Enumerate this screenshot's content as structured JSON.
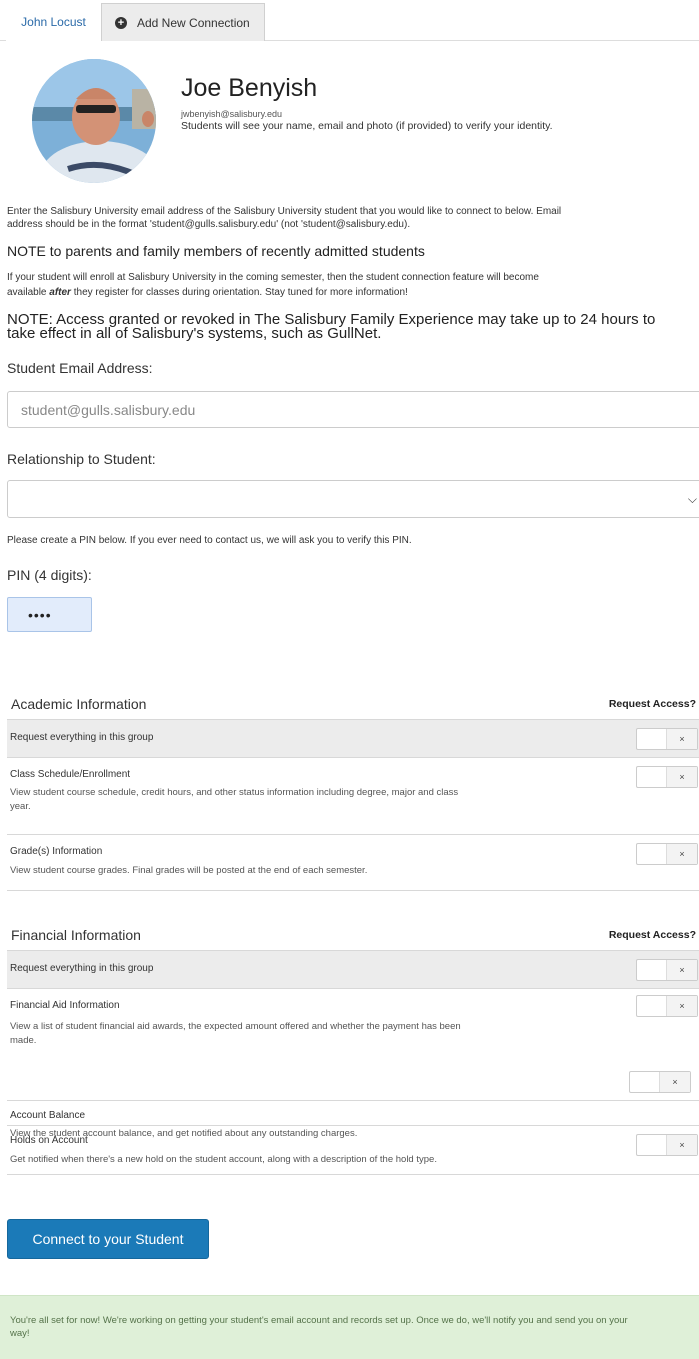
{
  "tabs": {
    "active_label": "John Locust",
    "add_label": "Add New Connection"
  },
  "profile": {
    "name": "Joe Benyish",
    "email": "jwbenyish@salisbury.edu",
    "note": "Students will see your name, email and photo (if provided) to verify your identity."
  },
  "instructions": {
    "line1": "Enter the Salisbury University email address of the Salisbury University student that you would like to connect to below. Email",
    "line2": "address should be in the format 'student@gulls.salisbury.edu' (not 'student@salisbury.edu).",
    "parents_heading": "NOTE to parents and family members of recently admitted students",
    "parents_line1": "If your student will enroll at Salisbury University in the coming semester, then the student connection feature will become",
    "parents_line2_pre": "available ",
    "parents_line2_em": "after",
    "parents_line2_post": " they register for classes during orientation. Stay tuned for more information!",
    "access_note_line1": "NOTE: Access granted or revoked in The Salisbury Family Experience may take up to 24 hours to",
    "access_note_line2": "take effect in all of Salisbury's systems, such as GullNet."
  },
  "form": {
    "email_label": "Student Email Address:",
    "email_placeholder": "student@gulls.salisbury.edu",
    "relationship_label": "Relationship to Student:",
    "relationship_value": "",
    "pin_intro": "Please create a PIN below. If you ever need to contact us, we will ask you to verify this PIN.",
    "pin_label": "PIN (4 digits):",
    "pin_value": "••••"
  },
  "groups": [
    {
      "title": "Academic Information",
      "request_label": "Request Access?",
      "request_all": "Request everything in this group",
      "items": [
        {
          "title": "Class Schedule/Enrollment",
          "desc_line1": "View student course schedule, credit hours, and other status information including degree, major and class",
          "desc_line2": "year."
        },
        {
          "title": "Grade(s) Information",
          "desc_line1": "View student course grades. Final grades will be posted at the end of each semester.",
          "desc_line2": ""
        }
      ]
    },
    {
      "title": "Financial Information",
      "request_label": "Request Access?",
      "request_all": "Request everything in this group",
      "items": [
        {
          "title": "Financial Aid Information",
          "desc_line1": "View a list of student financial aid awards, the expected amount offered and whether the payment has been",
          "desc_line2": "made."
        },
        {
          "title": "Account Balance",
          "desc_line1": "View the student account balance, and get notified about any outstanding charges.",
          "desc_line2": ""
        },
        {
          "title": "Holds on Account",
          "desc_line1": "Get notified when there's a new hold on the student account, along with a description of the hold type.",
          "desc_line2": ""
        }
      ]
    }
  ],
  "toggle_symbol": "×",
  "connect_button": "Connect to your Student",
  "alert": {
    "line1": "You're all set for now! We're working on getting your student's email account and records set up. Once we do, we'll notify you and send you on your",
    "line2": "way!"
  },
  "colors": {
    "primary_button": "#1b7ab8",
    "alert_bg": "#dff0d8",
    "link": "#2a6aa8"
  }
}
